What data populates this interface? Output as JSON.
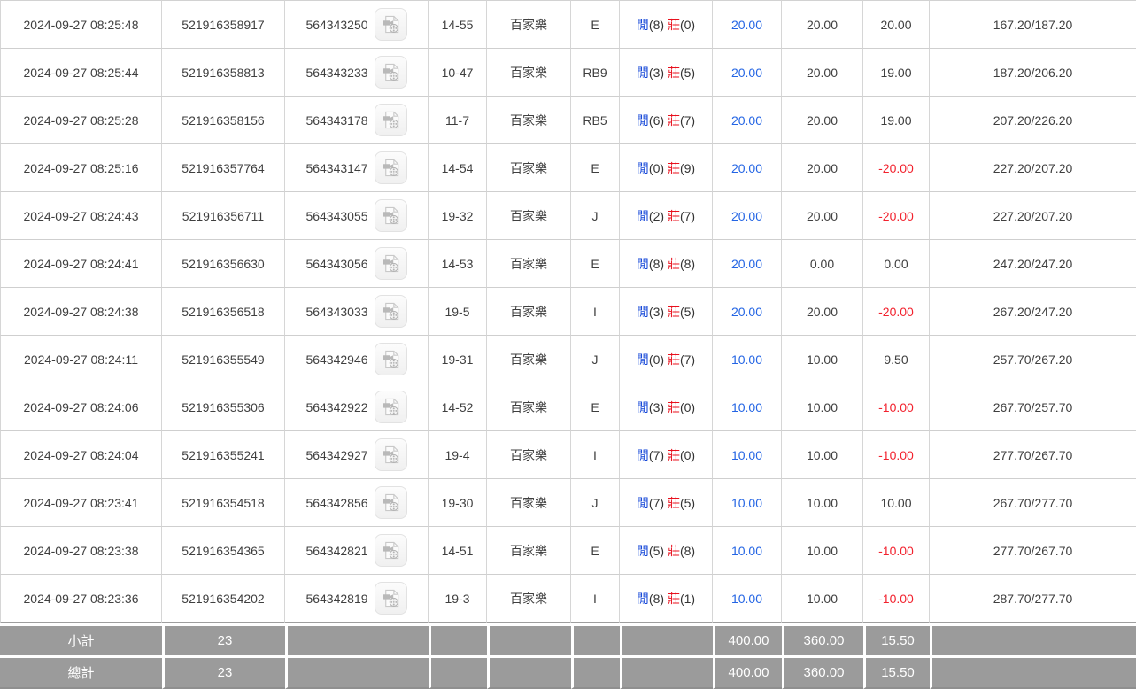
{
  "labels": {
    "player": "閒",
    "banker": "莊"
  },
  "icons": {
    "video": "video-file-icon"
  },
  "colors": {
    "link_blue": "#2465e4",
    "player_blue": "#1547d8",
    "banker_red": "#e8111e",
    "negative_red": "#f2222e",
    "footer_bg": "#9b9b9b",
    "border_grey": "#d6d6d6"
  },
  "rows": [
    {
      "time": "2024-09-27 08:25:48",
      "bet_id": "521916358917",
      "round_id": "564343250",
      "table_no": "14-55",
      "game": "百家樂",
      "dealer": "E",
      "p": "(8)",
      "b": "(0)",
      "bet": "20.00",
      "valid_bet": "20.00",
      "win_loss": "20.00",
      "balance": "167.20/187.20"
    },
    {
      "time": "2024-09-27 08:25:44",
      "bet_id": "521916358813",
      "round_id": "564343233",
      "table_no": "10-47",
      "game": "百家樂",
      "dealer": "RB9",
      "p": "(3)",
      "b": "(5)",
      "bet": "20.00",
      "valid_bet": "20.00",
      "win_loss": "19.00",
      "balance": "187.20/206.20"
    },
    {
      "time": "2024-09-27 08:25:28",
      "bet_id": "521916358156",
      "round_id": "564343178",
      "table_no": "11-7",
      "game": "百家樂",
      "dealer": "RB5",
      "p": "(6)",
      "b": "(7)",
      "bet": "20.00",
      "valid_bet": "20.00",
      "win_loss": "19.00",
      "balance": "207.20/226.20"
    },
    {
      "time": "2024-09-27 08:25:16",
      "bet_id": "521916357764",
      "round_id": "564343147",
      "table_no": "14-54",
      "game": "百家樂",
      "dealer": "E",
      "p": "(0)",
      "b": "(9)",
      "bet": "20.00",
      "valid_bet": "20.00",
      "win_loss": "-20.00",
      "balance": "227.20/207.20"
    },
    {
      "time": "2024-09-27 08:24:43",
      "bet_id": "521916356711",
      "round_id": "564343055",
      "table_no": "19-32",
      "game": "百家樂",
      "dealer": "J",
      "p": "(2)",
      "b": "(7)",
      "bet": "20.00",
      "valid_bet": "20.00",
      "win_loss": "-20.00",
      "balance": "227.20/207.20"
    },
    {
      "time": "2024-09-27 08:24:41",
      "bet_id": "521916356630",
      "round_id": "564343056",
      "table_no": "14-53",
      "game": "百家樂",
      "dealer": "E",
      "p": "(8)",
      "b": "(8)",
      "bet": "20.00",
      "valid_bet": "0.00",
      "win_loss": "0.00",
      "balance": "247.20/247.20"
    },
    {
      "time": "2024-09-27 08:24:38",
      "bet_id": "521916356518",
      "round_id": "564343033",
      "table_no": "19-5",
      "game": "百家樂",
      "dealer": "I",
      "p": "(3)",
      "b": "(5)",
      "bet": "20.00",
      "valid_bet": "20.00",
      "win_loss": "-20.00",
      "balance": "267.20/247.20"
    },
    {
      "time": "2024-09-27 08:24:11",
      "bet_id": "521916355549",
      "round_id": "564342946",
      "table_no": "19-31",
      "game": "百家樂",
      "dealer": "J",
      "p": "(0)",
      "b": "(7)",
      "bet": "10.00",
      "valid_bet": "10.00",
      "win_loss": "9.50",
      "balance": "257.70/267.20"
    },
    {
      "time": "2024-09-27 08:24:06",
      "bet_id": "521916355306",
      "round_id": "564342922",
      "table_no": "14-52",
      "game": "百家樂",
      "dealer": "E",
      "p": "(3)",
      "b": "(0)",
      "bet": "10.00",
      "valid_bet": "10.00",
      "win_loss": "-10.00",
      "balance": "267.70/257.70"
    },
    {
      "time": "2024-09-27 08:24:04",
      "bet_id": "521916355241",
      "round_id": "564342927",
      "table_no": "19-4",
      "game": "百家樂",
      "dealer": "I",
      "p": "(7)",
      "b": "(0)",
      "bet": "10.00",
      "valid_bet": "10.00",
      "win_loss": "-10.00",
      "balance": "277.70/267.70"
    },
    {
      "time": "2024-09-27 08:23:41",
      "bet_id": "521916354518",
      "round_id": "564342856",
      "table_no": "19-30",
      "game": "百家樂",
      "dealer": "J",
      "p": "(7)",
      "b": "(5)",
      "bet": "10.00",
      "valid_bet": "10.00",
      "win_loss": "10.00",
      "balance": "267.70/277.70"
    },
    {
      "time": "2024-09-27 08:23:38",
      "bet_id": "521916354365",
      "round_id": "564342821",
      "table_no": "14-51",
      "game": "百家樂",
      "dealer": "E",
      "p": "(5)",
      "b": "(8)",
      "bet": "10.00",
      "valid_bet": "10.00",
      "win_loss": "-10.00",
      "balance": "277.70/267.70"
    },
    {
      "time": "2024-09-27 08:23:36",
      "bet_id": "521916354202",
      "round_id": "564342819",
      "table_no": "19-3",
      "game": "百家樂",
      "dealer": "I",
      "p": "(8)",
      "b": "(1)",
      "bet": "10.00",
      "valid_bet": "10.00",
      "win_loss": "-10.00",
      "balance": "287.70/277.70"
    }
  ],
  "footer": {
    "rows": [
      {
        "label": "小計",
        "count": "23",
        "bet": "400.00",
        "valid_bet": "360.00",
        "win_loss": "15.50"
      },
      {
        "label": "總計",
        "count": "23",
        "bet": "400.00",
        "valid_bet": "360.00",
        "win_loss": "15.50"
      }
    ]
  }
}
